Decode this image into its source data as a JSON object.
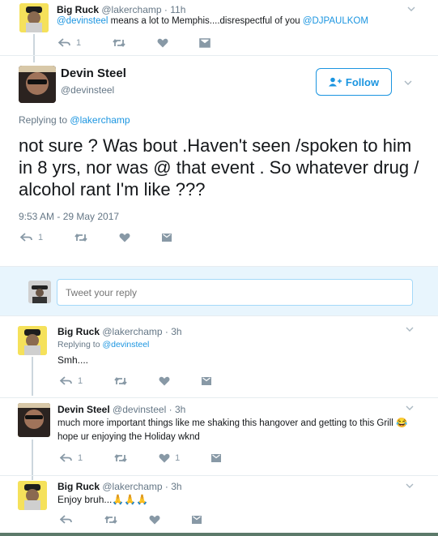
{
  "colors": {
    "link": "#1b95e0",
    "muted": "#657786",
    "icon": "#8899a6",
    "avatar_bg": "#f5e15b"
  },
  "top_tweet": {
    "name": "Big Ruck",
    "handle": "@lakerchamp",
    "time": "· 11h",
    "mention": "@devinsteel",
    "text": "means a lot to Memphis....disrespectful of you",
    "mention2": "@DJPAULKOM",
    "reply_count": "1",
    "retweet_count": "",
    "like_count": ""
  },
  "main_tweet": {
    "name": "Devin Steel",
    "handle": "@devinsteel",
    "follow_label": "Follow",
    "replying_prefix": "Replying to",
    "replying_to": "@lakerchamp",
    "text": "not sure ? Was bout  .Haven't seen /spoken to him in 8 yrs, nor was @ that event . So whatever drug / alcohol rant I'm like ???",
    "timestamp": "9:53 AM - 29 May 2017",
    "reply_count": "1"
  },
  "composer": {
    "placeholder": "Tweet your reply"
  },
  "replies": [
    {
      "name": "Big Ruck",
      "handle": "@lakerchamp",
      "time": "· 3h",
      "replying_prefix": "Replying to",
      "replying_to": "@devinsteel",
      "text": "Smh....",
      "reply_count": "1",
      "like_count": ""
    },
    {
      "name": "Devin Steel",
      "handle": "@devinsteel",
      "time": "· 3h",
      "text": "much more important things like me shaking this hangover and getting to this Grill 😂 hope ur enjoying the Holiday wknd",
      "reply_count": "1",
      "like_count": "1"
    },
    {
      "name": "Big Ruck",
      "handle": "@lakerchamp",
      "time": "· 3h",
      "text": "Enjoy bruh...🙏🙏🙏",
      "reply_count": "",
      "like_count": ""
    }
  ]
}
